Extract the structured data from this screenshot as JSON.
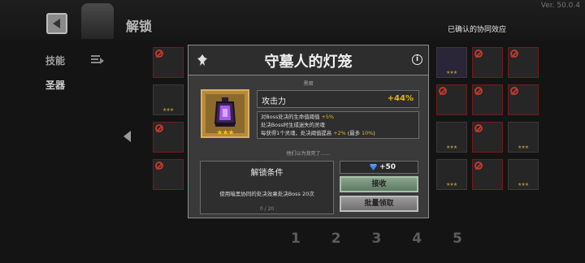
{
  "version": "Ver. 50.0.4",
  "header": {
    "title": "解锁",
    "back_icon": "back-arrow-icon"
  },
  "confirmed_label": "已确认的协同效应",
  "sidebar": {
    "items": [
      {
        "label": "技能"
      },
      {
        "label": "圣器"
      }
    ]
  },
  "pagination": {
    "pages": "1 2 3 4 5"
  },
  "modal": {
    "title": "守墓人的灯笼",
    "rarity_label": "黑暗",
    "item_stars": "★★★",
    "stat": {
      "label": "攻击力",
      "value": "+44%"
    },
    "description": {
      "line1_prefix": "对Boss处决的生命值阈值 ",
      "line1_value": "+5%",
      "line2": "处决Boss时生成迷失的灵魂",
      "line3_prefix": "每获得1个灵魂，处决阈值提高 ",
      "line3_value": "+2%",
      "line3_suffix_a": " (最多 ",
      "line3_suffix_value": "10%",
      "line3_suffix_b": ")"
    },
    "hint": "他们以为我死了……",
    "unlock": {
      "title": "解锁条件",
      "description": "使用暗黑协同的处决效果处决Boss 20次",
      "progress": "0 / 20"
    },
    "reward": {
      "icon": "gem-icon",
      "value": "+50"
    },
    "receive_label": "接收",
    "batch_label": "批量领取"
  },
  "colors": {
    "accent_gold": "#e7b41c",
    "receive_button": "#7a967e",
    "background": "#141414"
  }
}
